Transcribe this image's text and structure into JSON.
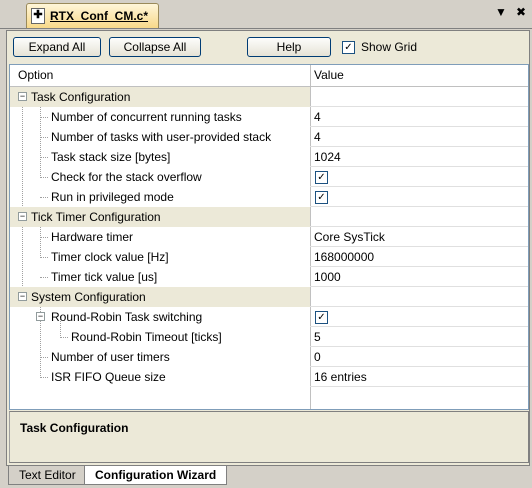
{
  "window": {
    "tab_title": "RTX_Conf_CM.c*",
    "file_icon_glyph": "✚",
    "controls": {
      "dropdown": "▼",
      "close": "✖"
    }
  },
  "toolbar": {
    "expand_all": "Expand All",
    "collapse_all": "Collapse All",
    "help": "Help",
    "show_grid": "Show Grid",
    "show_grid_checked": true
  },
  "grid": {
    "columns": {
      "option": "Option",
      "value": "Value"
    },
    "rows": [
      {
        "name": "Task Configuration",
        "value": "",
        "type": "group"
      },
      {
        "name": "Number of concurrent running tasks",
        "value": "4",
        "type": "text"
      },
      {
        "name": "Number of tasks with user-provided stack",
        "value": "4",
        "type": "text"
      },
      {
        "name": "Task stack size [bytes]",
        "value": "1024",
        "type": "text"
      },
      {
        "name": "Check for the stack overflow",
        "value": "✓",
        "type": "check"
      },
      {
        "name": "Run in privileged mode",
        "value": "✓",
        "type": "check"
      },
      {
        "name": "Tick Timer Configuration",
        "value": "",
        "type": "group"
      },
      {
        "name": "Hardware timer",
        "value": "Core SysTick",
        "type": "text"
      },
      {
        "name": "Timer clock value [Hz]",
        "value": "168000000",
        "type": "text"
      },
      {
        "name": "Timer tick value [us]",
        "value": "1000",
        "type": "text"
      },
      {
        "name": "System Configuration",
        "value": "",
        "type": "group"
      },
      {
        "name": "Round-Robin Task switching",
        "value": "✓",
        "type": "check"
      },
      {
        "name": "Round-Robin Timeout [ticks]",
        "value": "5",
        "type": "text"
      },
      {
        "name": "Number of user timers",
        "value": "0",
        "type": "text"
      },
      {
        "name": "ISR FIFO Queue size",
        "value": "16 entries",
        "type": "text"
      }
    ],
    "toggle_glyph": "−"
  },
  "description": {
    "title": "Task Configuration"
  },
  "bottom_tabs": {
    "text_editor": "Text Editor",
    "config_wizard": "Configuration Wizard"
  },
  "colors": {
    "tab_active": "#f8d98a",
    "group_bg": "#ece9d8",
    "panel_bg": "#ece9d8"
  }
}
